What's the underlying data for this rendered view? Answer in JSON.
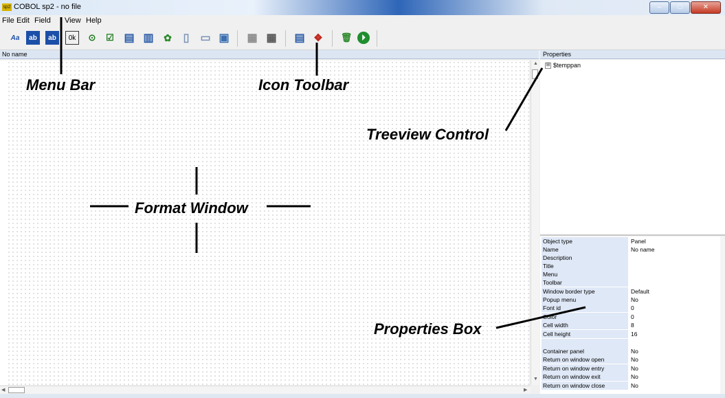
{
  "window": {
    "app_icon": "sp2",
    "title": "COBOL sp2 - no file",
    "controls": {
      "minimize": "–",
      "maximize": "□",
      "close": "✕"
    }
  },
  "menu": {
    "items": [
      "File",
      "Edit",
      "Field",
      "View",
      "Help"
    ]
  },
  "toolbar": {
    "icons": [
      {
        "name": "static-text-icon",
        "glyph": "Aa",
        "color": "#1c4fa8"
      },
      {
        "name": "entry-field-icon",
        "glyph": "ab",
        "color": "#1c4fa8"
      },
      {
        "name": "entry-field-alt-icon",
        "glyph": "ab",
        "color": "#ffffff"
      },
      {
        "name": "push-button-icon",
        "glyph": "0k",
        "color": "#000000"
      },
      {
        "name": "radio-button-icon",
        "glyph": "⊙",
        "color": "#1b7a1b"
      },
      {
        "name": "check-box-icon",
        "glyph": "☑",
        "color": "#1b7a1b"
      },
      {
        "name": "list-box-icon",
        "glyph": "▤",
        "color": "#2a5ca8"
      },
      {
        "name": "combo-box-icon",
        "glyph": "▥",
        "color": "#2a5ca8"
      },
      {
        "name": "bitmap-icon",
        "glyph": "✿",
        "color": "#2d8a2d"
      },
      {
        "name": "vertical-bar-icon",
        "glyph": "▯",
        "color": "#7a93b8"
      },
      {
        "name": "horizontal-bar-icon",
        "glyph": "▭",
        "color": "#7a93b8"
      },
      {
        "name": "group-box-icon",
        "glyph": "▣",
        "color": "#3b6fb0"
      },
      {
        "name": "tab-control-icon",
        "glyph": "▦",
        "color": "#8a8a8a"
      },
      {
        "name": "grid-icon",
        "glyph": "▦",
        "color": "#555555"
      },
      {
        "name": "panel-properties-icon",
        "glyph": "▤",
        "color": "#2a5ca8"
      },
      {
        "name": "generate-icon",
        "glyph": "❖",
        "color": "#c0281e"
      },
      {
        "name": "delete-icon",
        "glyph": "🗑",
        "color": "#2d8a2d"
      },
      {
        "name": "run-icon",
        "glyph": "⏵",
        "color": "#1e8e2e"
      }
    ]
  },
  "format_window": {
    "header": "No name",
    "label": "Format Window"
  },
  "properties": {
    "header": "Properties",
    "tree": {
      "node_label": "$temppan",
      "expander": "⊞"
    },
    "rows": [
      {
        "name": "Object type",
        "value": "Panel"
      },
      {
        "name": "Name",
        "value": "No name"
      },
      {
        "name": "Description",
        "value": ""
      },
      {
        "name": "Title",
        "value": ""
      },
      {
        "name": "Menu",
        "value": ""
      },
      {
        "name": "Toolbar",
        "value": ""
      },
      {
        "name": "Window border type",
        "value": "Default"
      },
      {
        "name": "Popup menu",
        "value": "No"
      },
      {
        "name": "Font id",
        "value": "0"
      },
      {
        "name": "Color",
        "value": "0"
      },
      {
        "name": "Cell width",
        "value": "8"
      },
      {
        "name": "Cell height",
        "value": "16"
      },
      {
        "name": "",
        "value": ""
      },
      {
        "name": "Container panel",
        "value": "No"
      },
      {
        "name": "Return on window open",
        "value": "No"
      },
      {
        "name": "Return on window entry",
        "value": "No"
      },
      {
        "name": "Return on window exit",
        "value": "No"
      },
      {
        "name": "Return on window close",
        "value": "No"
      }
    ]
  },
  "annotations": {
    "menu_bar": "Menu Bar",
    "icon_toolbar": "Icon Toolbar",
    "treeview_control": "Treeview Control",
    "format_window": "Format Window",
    "properties_box": "Properties Box"
  },
  "colors": {
    "panel_header": "#dce6f3",
    "property_name_bg": "#dfe8f6",
    "grid_dot": "#9a9a9a"
  }
}
